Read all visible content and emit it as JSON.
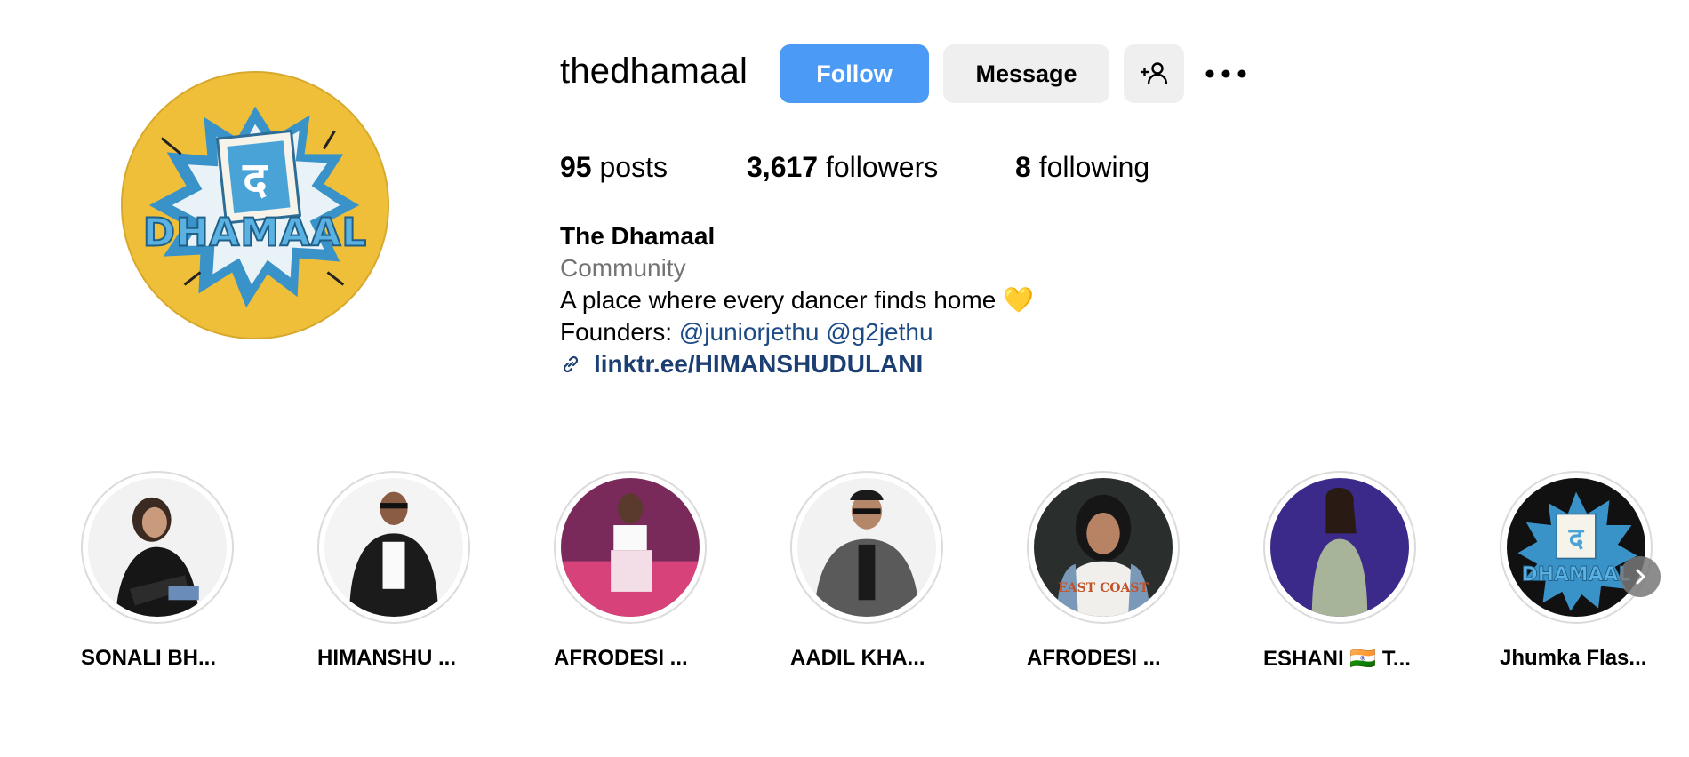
{
  "profile": {
    "username": "thedhamaal",
    "avatar_icon": "dhamaal-logo"
  },
  "actions": {
    "follow_label": "Follow",
    "message_label": "Message",
    "suggest_icon": "add-person-icon",
    "more_icon": "more-options-icon"
  },
  "stats": {
    "posts_count": "95",
    "posts_label": "posts",
    "followers_count": "3,617",
    "followers_label": "followers",
    "following_count": "8",
    "following_label": "following"
  },
  "bio": {
    "name": "The Dhamaal",
    "category": "Community",
    "text": "A place where every dancer finds home 💛",
    "founders_prefix": "Founders: ",
    "mention_1": "@juniorjethu",
    "mention_2": "@g2jethu",
    "link_text": "linktr.ee/HIMANSHUDULANI"
  },
  "highlights": [
    {
      "label": "SONALI BH..."
    },
    {
      "label": "HIMANSHU ..."
    },
    {
      "label": "AFRODESI ..."
    },
    {
      "label": "AADIL KHA..."
    },
    {
      "label": "AFRODESI ..."
    },
    {
      "label": "ESHANI 🇮🇳 T..."
    },
    {
      "label": "Jhumka Flas..."
    }
  ],
  "colors": {
    "follow_button": "#4a9af6",
    "secondary_button": "#efefef",
    "mention": "#1b4a85",
    "avatar_bg": "#efbf3a"
  }
}
